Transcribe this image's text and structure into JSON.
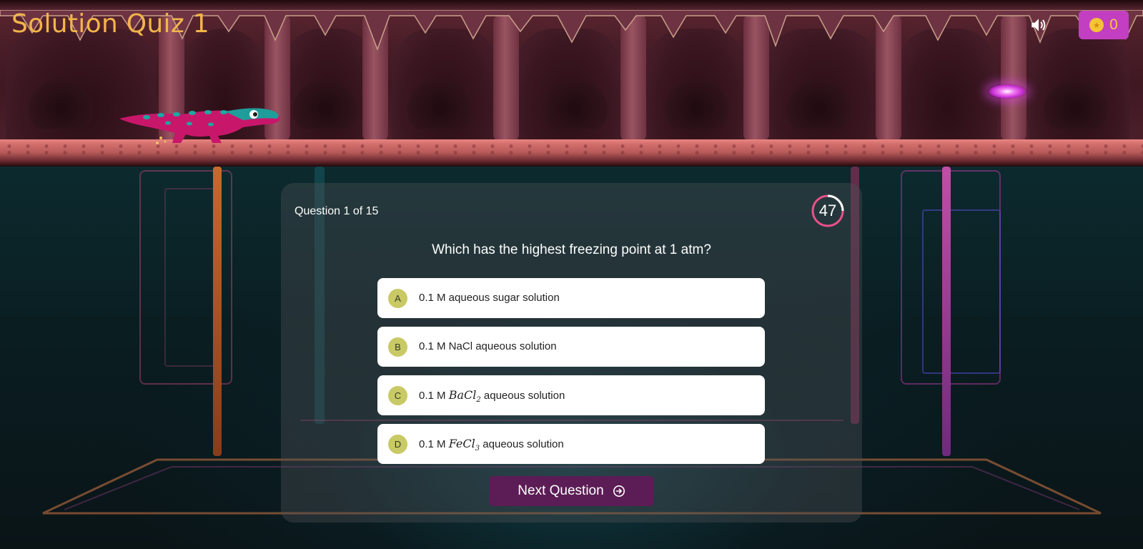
{
  "game": {
    "title": "Solution Quiz 1",
    "coins": "0",
    "icons": {
      "sound": "speaker-icon",
      "coin": "coin-icon",
      "portal": "portal-icon",
      "player": "dinosaur-sprite"
    }
  },
  "quiz": {
    "counter": "Question 1 of 15",
    "timer": "47",
    "question": "Which has the highest freezing point at 1 atm?",
    "options": [
      {
        "letter": "A",
        "prefix": "0.1 M aqueous sugar solution",
        "formula": "",
        "subscript": "",
        "suffix": ""
      },
      {
        "letter": "B",
        "prefix": "0.1 M NaCl aqueous solution",
        "formula": "",
        "subscript": "",
        "suffix": ""
      },
      {
        "letter": "C",
        "prefix": "0.1 M ",
        "formula": "BaCl",
        "subscript": "2",
        "suffix": " aqueous solution"
      },
      {
        "letter": "D",
        "prefix": "0.1 M ",
        "formula": "FeCl",
        "subscript": "3",
        "suffix": " aqueous solution"
      }
    ],
    "next_label": "Next Question"
  },
  "colors": {
    "title": "#f2b54a",
    "coin_badge": "#c23fc1",
    "option_letter_bg": "#c9c966",
    "next_button": "#5c1c55",
    "timer_ring": "#e8508a"
  }
}
